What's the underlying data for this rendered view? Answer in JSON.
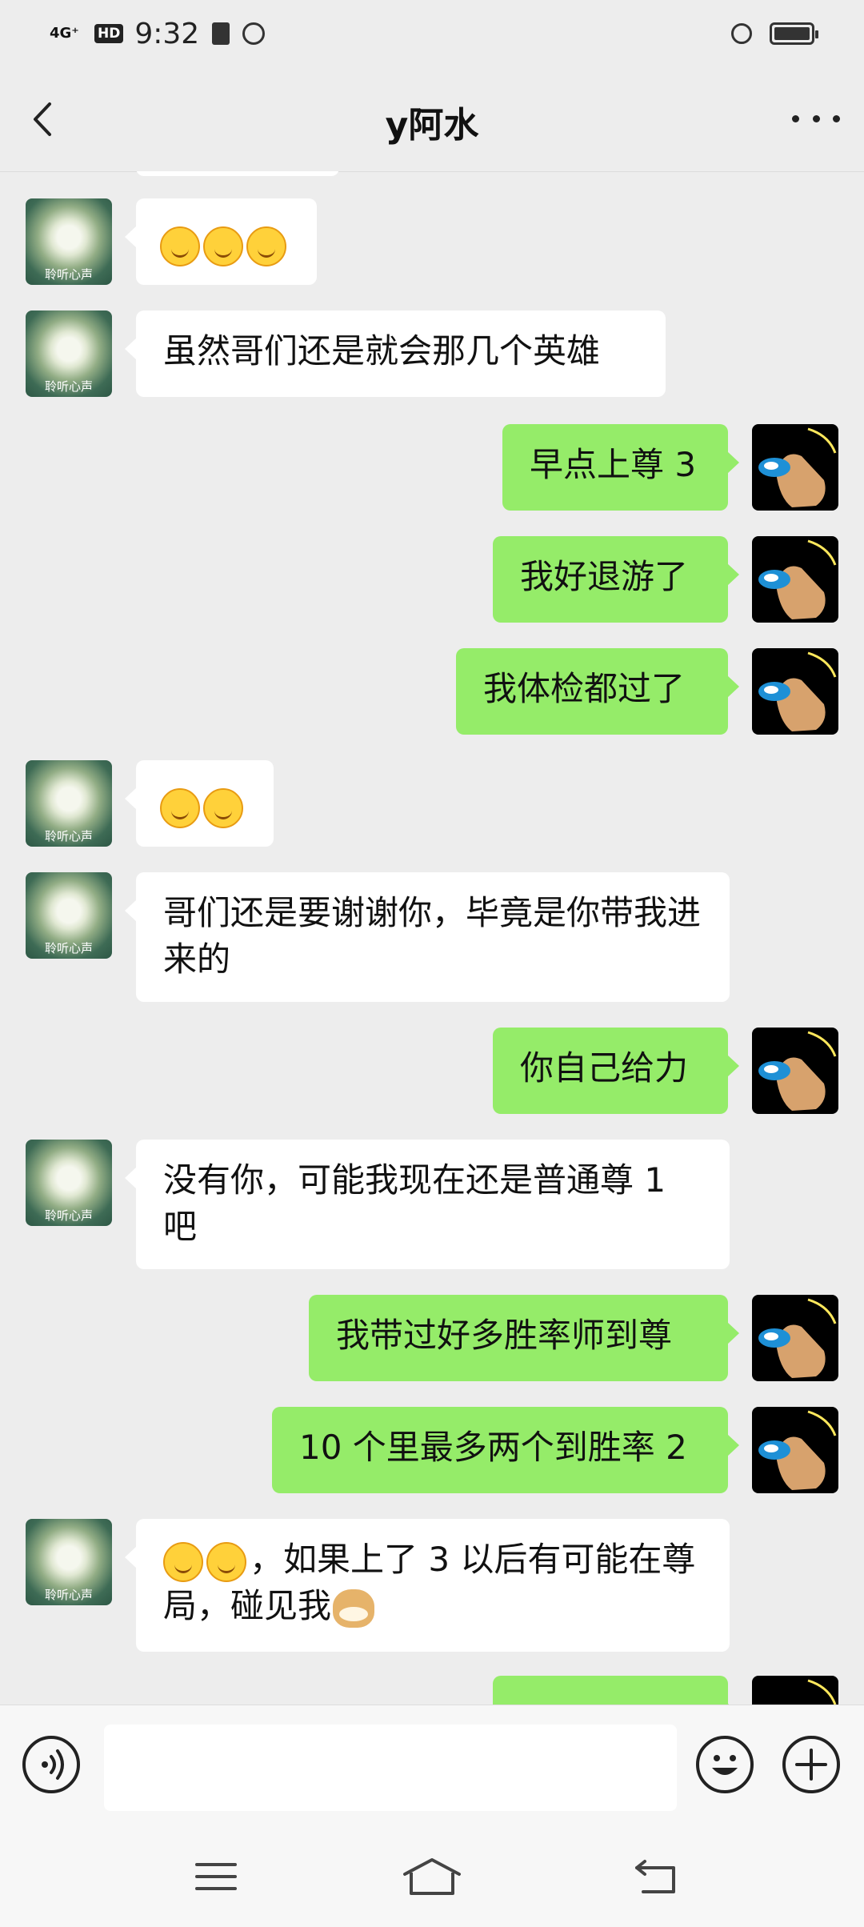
{
  "status_bar": {
    "network": "4G⁺",
    "hd": "HD",
    "time": "9:32"
  },
  "header": {
    "title": "y阿水"
  },
  "avatar_caption": "聆听心声",
  "messages": [
    {
      "from": "them",
      "text": "",
      "emoji_count": 3
    },
    {
      "from": "them",
      "text": "虽然哥们还是就会那几个英雄"
    },
    {
      "from": "me",
      "text": "早点上尊 3"
    },
    {
      "from": "me",
      "text": "我好退游了"
    },
    {
      "from": "me",
      "text": "我体检都过了"
    },
    {
      "from": "them",
      "text": "",
      "emoji_count": 2
    },
    {
      "from": "them",
      "text": "哥们还是要谢谢你，毕竟是你带我进来的"
    },
    {
      "from": "me",
      "text": "你自己给力"
    },
    {
      "from": "them",
      "text": "没有你，可能我现在还是普通尊 1 吧"
    },
    {
      "from": "me",
      "text": "我带过好多胜率师到尊"
    },
    {
      "from": "me",
      "text": "10 个里最多两个到胜率 2"
    },
    {
      "from": "them",
      "text": "，如果上了 3 以后有可能在尊局，碰见我",
      "emoji_count": 2,
      "trailing_emoji": "doge"
    }
  ],
  "input": {
    "placeholder": ""
  }
}
